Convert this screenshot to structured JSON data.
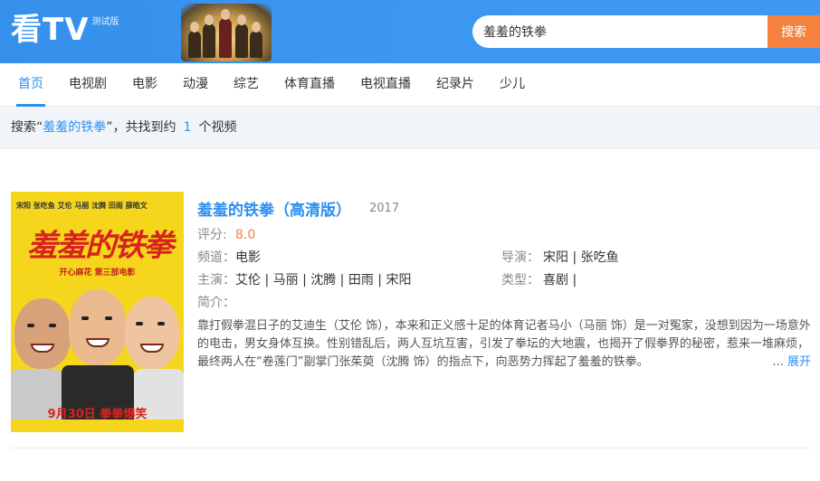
{
  "header": {
    "logo": "看TV",
    "logo_tag": "测试版",
    "search_value": "羞羞的铁拳",
    "search_button": "搜索"
  },
  "nav": {
    "items": [
      {
        "label": "首页",
        "active": true
      },
      {
        "label": "电视剧"
      },
      {
        "label": "电影"
      },
      {
        "label": "动漫"
      },
      {
        "label": "综艺"
      },
      {
        "label": "体育直播"
      },
      {
        "label": "电视直播"
      },
      {
        "label": "纪录片"
      },
      {
        "label": "少儿"
      }
    ]
  },
  "summary": {
    "prefix": "搜索“",
    "keyword": "羞羞的铁拳",
    "middle": "”，共找到约",
    "count": "1",
    "suffix": "个视频"
  },
  "result": {
    "poster": {
      "cast": "宋阳 张吃鱼  艾伦 马丽 沈腾 田雨 薛皓文",
      "title": "羞羞的铁拳",
      "subtitle": "开心麻花 第三部电影",
      "date": "9月30日 拳拳爆笑"
    },
    "title": "羞羞的铁拳（高清版）",
    "year": "2017",
    "rating_label": "评分:",
    "rating": "8.0",
    "channel_label": "频道：",
    "channel": "电影",
    "director_label": "导演：",
    "director": "宋阳 | 张吃鱼",
    "cast_label": "主演：",
    "cast": "艾伦 | 马丽 | 沈腾 | 田雨 | 宋阳",
    "genre_label": "类型：",
    "genre": "喜剧 |",
    "synopsis_label": "简介：",
    "synopsis": "靠打假拳混日子的艾迪生（艾伦 饰），本来和正义感十足的体育记者马小（马丽 饰）是一对冤家，没想到因为一场意外的电击，男女身体互换。性别错乱后，两人互坑互害，引发了拳坛的大地震，也揭开了假拳界的秘密，惹来一堆麻烦，最终两人在“卷莲门”副掌门张茱萸（沈腾 饰）的指点下，向恶势力挥起了羞羞的铁拳。",
    "ellipsis": "...",
    "expand": "展开"
  },
  "colors": {
    "brand": "#2d8ff0",
    "accent": "#f5813f",
    "poster_bg": "#f6d61c",
    "poster_title": "#d8231f"
  }
}
